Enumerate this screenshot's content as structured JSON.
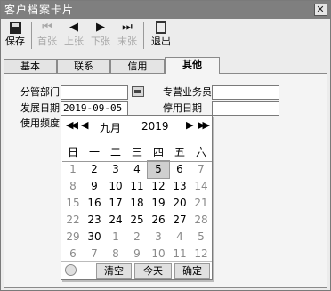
{
  "window": {
    "title": "客户档案卡片",
    "close_glyph": "✕"
  },
  "toolbar": {
    "buttons": [
      {
        "label": "保存",
        "icon": "floppy-disk-icon"
      },
      {
        "label": "首张",
        "icon": "first-record-icon",
        "glyph": "⏮"
      },
      {
        "label": "上张",
        "icon": "prev-record-icon",
        "glyph": "◀"
      },
      {
        "label": "下张",
        "icon": "next-record-icon",
        "glyph": "▶"
      },
      {
        "label": "末张",
        "icon": "last-record-icon",
        "glyph": "⏭"
      },
      {
        "label": "退出",
        "icon": "exit-icon"
      }
    ]
  },
  "tabs": [
    {
      "label": "基本"
    },
    {
      "label": "联系"
    },
    {
      "label": "信用"
    },
    {
      "label": "其他",
      "active": true
    }
  ],
  "form": {
    "dept_label": "分管部门",
    "dept_value": "",
    "salesman_label": "专营业务员",
    "salesman_value": "",
    "dev_date_label": "发展日期",
    "dev_date_value": "2019-09-05",
    "stop_date_label": "停用日期",
    "stop_date_value": "",
    "usage_freq_label": "使用频度"
  },
  "calendar": {
    "prev_year_glyph": "◀◀",
    "prev_month_glyph": "◀",
    "next_month_glyph": "▶",
    "next_year_glyph": "▶▶",
    "month": "九月",
    "year": "2019",
    "weekdays": [
      "日",
      "一",
      "二",
      "三",
      "四",
      "五",
      "六"
    ],
    "weeks": [
      [
        "1",
        "2",
        "3",
        "4",
        "5",
        "6",
        "7"
      ],
      [
        "8",
        "9",
        "10",
        "11",
        "12",
        "13",
        "14"
      ],
      [
        "15",
        "16",
        "17",
        "18",
        "19",
        "20",
        "21"
      ],
      [
        "22",
        "23",
        "24",
        "25",
        "26",
        "27",
        "28"
      ],
      [
        "29",
        "30",
        "1",
        "2",
        "3",
        "4",
        "5"
      ],
      [
        "6",
        "7",
        "8",
        "9",
        "10",
        "11",
        "12"
      ]
    ],
    "selected_day": "5",
    "clear_label": "清空",
    "today_label": "今天",
    "ok_label": "确定"
  },
  "colors": {
    "titlebar": "#7f7f7f",
    "window_bg": "#ececec",
    "disabled_text": "#a8a8a8",
    "selected_day_bg": "#cfcfcf"
  }
}
